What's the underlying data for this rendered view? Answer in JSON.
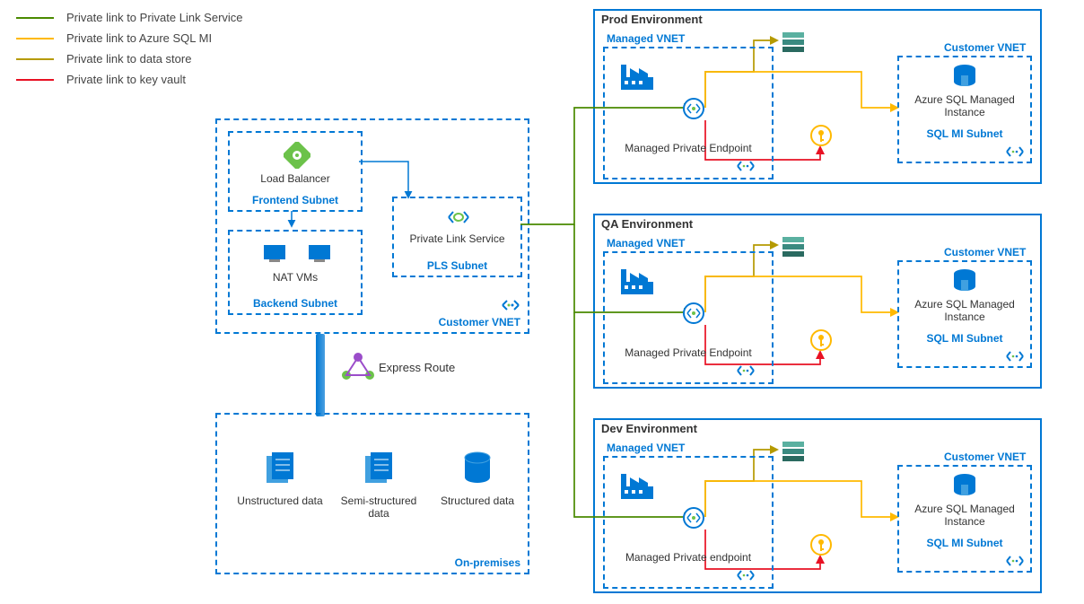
{
  "legend": [
    {
      "color": "#4a8a00",
      "label": "Private link to Private Link Service"
    },
    {
      "color": "#ffb900",
      "label": "Private link to Azure SQL MI"
    },
    {
      "color": "#b59a00",
      "label": "Private link to data store"
    },
    {
      "color": "#e81123",
      "label": "Private link to key vault"
    }
  ],
  "customerVnet": {
    "title": "Customer VNET",
    "frontend": {
      "subnet": "Frontend Subnet",
      "item": "Load Balancer"
    },
    "backend": {
      "subnet": "Backend Subnet",
      "item": "NAT VMs"
    },
    "pls": {
      "subnet": "PLS Subnet",
      "item": "Private Link Service"
    }
  },
  "expressRoute": "Express Route",
  "onPrem": {
    "title": "On-premises",
    "items": [
      "Unstructured data",
      "Semi-structured data",
      "Structured data"
    ]
  },
  "envs": [
    {
      "title": "Prod Environment",
      "mvnet": "Managed VNET",
      "mpe": "Managed Private Endpoint",
      "cvnet": "Customer VNET",
      "sql": "Azure SQL Managed Instance",
      "subnet": "SQL MI Subnet"
    },
    {
      "title": "QA Environment",
      "mvnet": "Managed VNET",
      "mpe": "Managed Private Endpoint",
      "cvnet": "Customer VNET",
      "sql": "Azure SQL Managed Instance",
      "subnet": "SQL MI Subnet"
    },
    {
      "title": "Dev Environment",
      "mvnet": "Managed VNET",
      "mpe": "Managed Private endpoint",
      "cvnet": "Customer VNET",
      "sql": "Azure SQL Managed Instance",
      "subnet": "SQL MI Subnet"
    }
  ]
}
